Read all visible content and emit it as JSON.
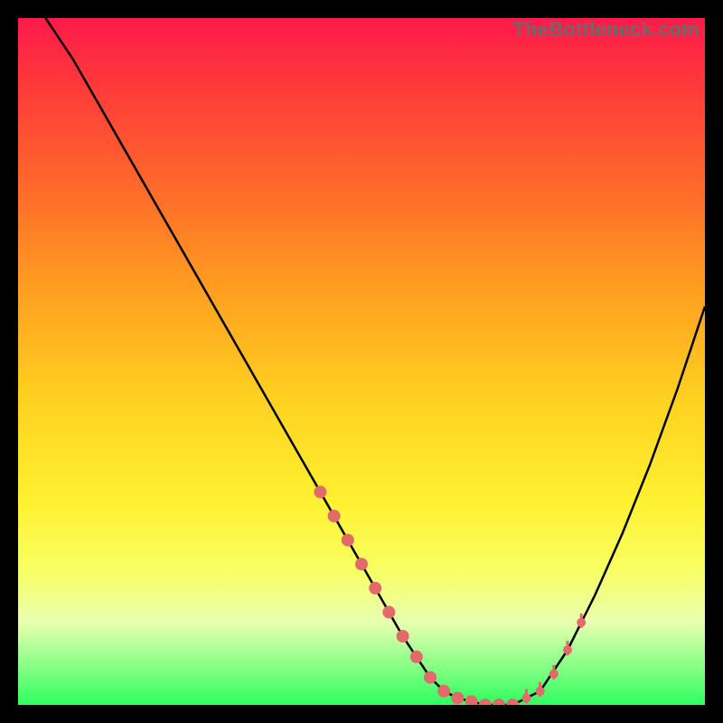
{
  "watermark": "TheBottleneck.com",
  "colors": {
    "background": "#000000",
    "gradient_top": "#ff1a4a",
    "gradient_bottom": "#30ff60",
    "curve": "#000000",
    "marker": "#e26a6a"
  },
  "chart_data": {
    "type": "line",
    "title": "",
    "xlabel": "",
    "ylabel": "",
    "xlim": [
      0,
      100
    ],
    "ylim": [
      0,
      100
    ],
    "grid": false,
    "legend": null,
    "series": [
      {
        "name": "bottleneck-curve",
        "x": [
          4,
          8,
          12,
          16,
          20,
          24,
          28,
          32,
          36,
          40,
          44,
          48,
          52,
          56,
          58,
          60,
          62,
          64,
          68,
          72,
          76,
          80,
          84,
          88,
          92,
          96,
          100
        ],
        "y": [
          100,
          94,
          87,
          80,
          73,
          66,
          59,
          52,
          45,
          38,
          31,
          24,
          17,
          10,
          7,
          4,
          2,
          1,
          0,
          0,
          2,
          8,
          16,
          25,
          35,
          46,
          58
        ]
      }
    ],
    "markers_left": {
      "x": [
        44,
        46,
        48,
        50,
        52,
        54,
        56,
        58,
        60
      ],
      "y": [
        31,
        27.5,
        24,
        20.5,
        17,
        13.5,
        10,
        7,
        4
      ]
    },
    "markers_bottom": {
      "x": [
        62,
        64,
        66,
        68,
        70,
        72
      ],
      "y": [
        2,
        1,
        0.5,
        0,
        0,
        0
      ]
    },
    "markers_right_ticks": {
      "x": [
        74,
        76,
        78,
        80,
        82
      ],
      "y": [
        1,
        2,
        4.5,
        8,
        12
      ]
    }
  }
}
